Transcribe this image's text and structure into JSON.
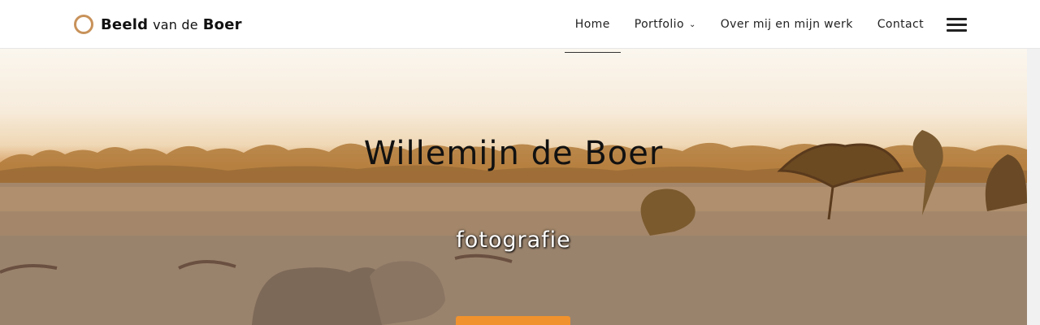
{
  "logo": {
    "part1": "Beeld",
    "part2": "van de",
    "part3": "Boer"
  },
  "nav": {
    "items": [
      {
        "label": "Home"
      },
      {
        "label": "Portfolio"
      },
      {
        "label": "Over mij en mijn werk"
      },
      {
        "label": "Contact"
      }
    ]
  },
  "hero": {
    "title": "Willemijn de Boer",
    "subtitle": "fotografie"
  },
  "colors": {
    "accent": "#c8925a",
    "button": "#f0922e"
  },
  "icons": {
    "menu": "hamburger-icon",
    "logo": "ring-icon",
    "dropdown": "chevron-down-icon"
  }
}
